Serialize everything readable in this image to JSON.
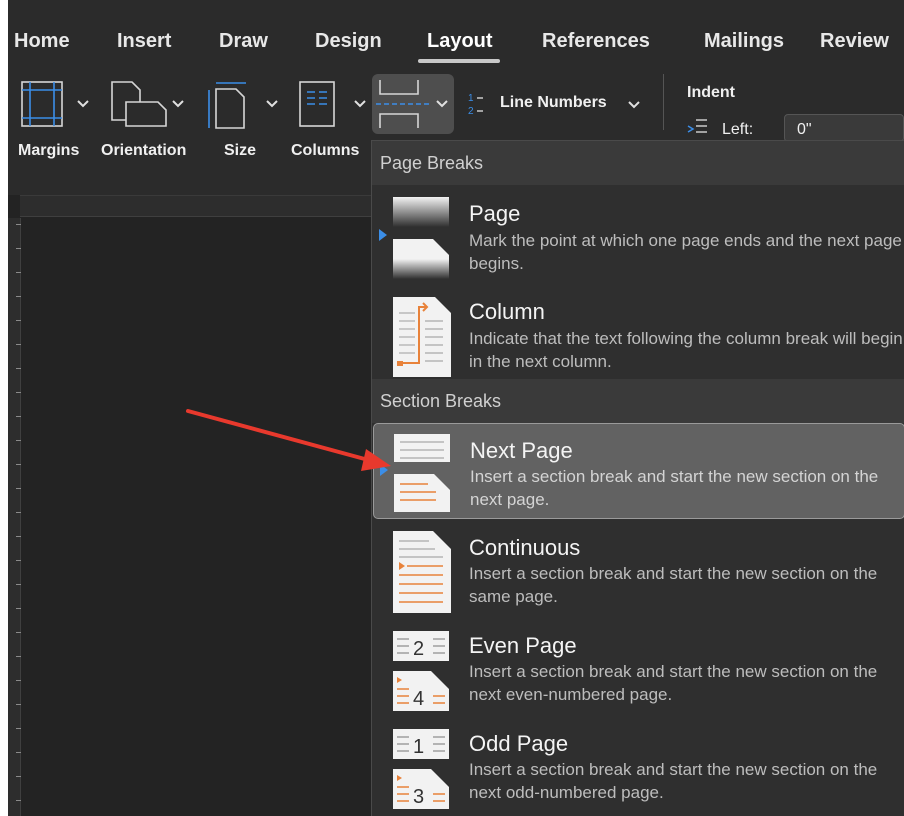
{
  "tabs": [
    {
      "label": "Home"
    },
    {
      "label": "Insert"
    },
    {
      "label": "Draw"
    },
    {
      "label": "Design"
    },
    {
      "label": "Layout",
      "active": true
    },
    {
      "label": "References"
    },
    {
      "label": "Mailings"
    },
    {
      "label": "Review"
    }
  ],
  "ribbon": {
    "margins": "Margins",
    "orientation": "Orientation",
    "size": "Size",
    "columns": "Columns",
    "line_numbers": "Line Numbers",
    "indent": "Indent",
    "left_label": "Left:",
    "left_value": "0\""
  },
  "menu": {
    "page_breaks_header": "Page Breaks",
    "section_breaks_header": "Section Breaks",
    "items": [
      {
        "title": "Page",
        "desc": "Mark the point at which one page ends and the next page begins."
      },
      {
        "title": "Column",
        "desc": "Indicate that the text following the column break will begin in the next column."
      },
      {
        "title": "Next Page",
        "desc": "Insert a section break and start the new section on the next page.",
        "highlighted": true
      },
      {
        "title": "Continuous",
        "desc": "Insert a section break and start the new section on the same page."
      },
      {
        "title": "Even Page",
        "desc": "Insert a section break and start the new section on the next even-numbered page."
      },
      {
        "title": "Odd Page",
        "desc": "Insert a section break and start the new section on the next odd-numbered page."
      }
    ]
  },
  "icons": {
    "even_page_numbers": [
      "2",
      "4"
    ],
    "odd_page_numbers": [
      "1",
      "3"
    ]
  },
  "colors": {
    "accent_blue": "#3b8ee8",
    "accent_orange": "#e8823a",
    "arrow_red": "#e8392d",
    "ribbon_bg": "#2b2b2b",
    "menu_bg": "#2f2f2f"
  }
}
